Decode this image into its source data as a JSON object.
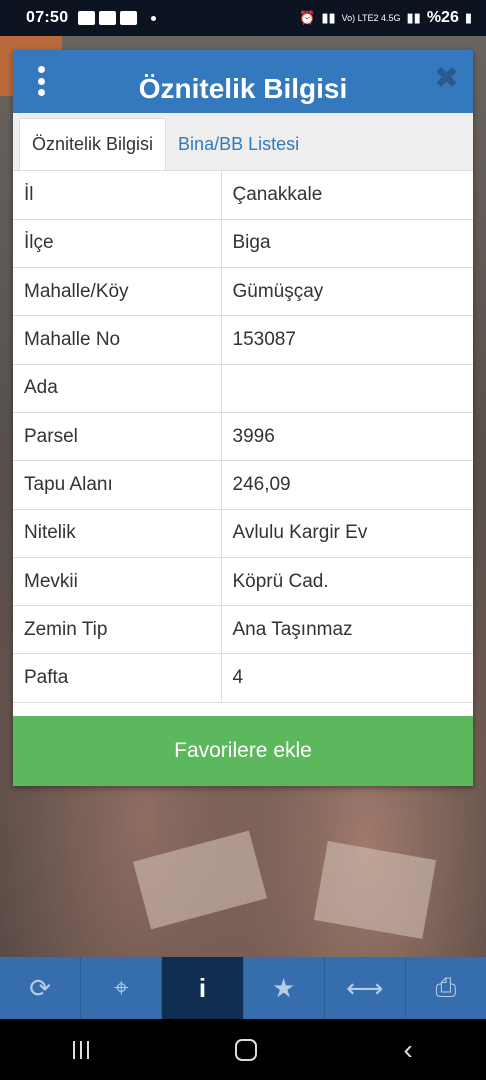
{
  "status_bar": {
    "time": "07:50",
    "network": "Vo) LTE2 4.5G",
    "battery": "%26"
  },
  "dialog": {
    "title": "Öznitelik Bilgisi",
    "tabs": [
      {
        "label": "Öznitelik Bilgisi",
        "active": true
      },
      {
        "label": "Bina/BB Listesi",
        "active": false
      }
    ],
    "rows": [
      {
        "key": "İl",
        "value": "Çanakkale"
      },
      {
        "key": "İlçe",
        "value": "Biga"
      },
      {
        "key": "Mahalle/Köy",
        "value": "Gümüşçay"
      },
      {
        "key": "Mahalle No",
        "value": "153087"
      },
      {
        "key": "Ada",
        "value": ""
      },
      {
        "key": "Parsel",
        "value": "3996"
      },
      {
        "key": "Tapu Alanı",
        "value": "246,09"
      },
      {
        "key": "Nitelik",
        "value": "Avlulu Kargir Ev"
      },
      {
        "key": "Mevkii",
        "value": "Köprü Cad."
      },
      {
        "key": "Zemin Tip",
        "value": "Ana Taşınmaz"
      },
      {
        "key": "Pafta",
        "value": "4"
      }
    ],
    "favorite_button": "Favorilere ekle"
  },
  "toolbar": {
    "items": [
      {
        "name": "refresh-icon",
        "glyph": "⟳"
      },
      {
        "name": "crosshair-icon",
        "glyph": "⌖"
      },
      {
        "name": "info-icon",
        "glyph": "i",
        "active": true
      },
      {
        "name": "star-icon",
        "glyph": "★"
      },
      {
        "name": "measure-icon",
        "glyph": "⟷"
      },
      {
        "name": "print-icon",
        "glyph": "⎙"
      }
    ]
  },
  "colors": {
    "header": "#3479bd",
    "favorite": "#5cb85c",
    "toolbar": "#356dad",
    "toolbar_active": "#0f2e52"
  }
}
